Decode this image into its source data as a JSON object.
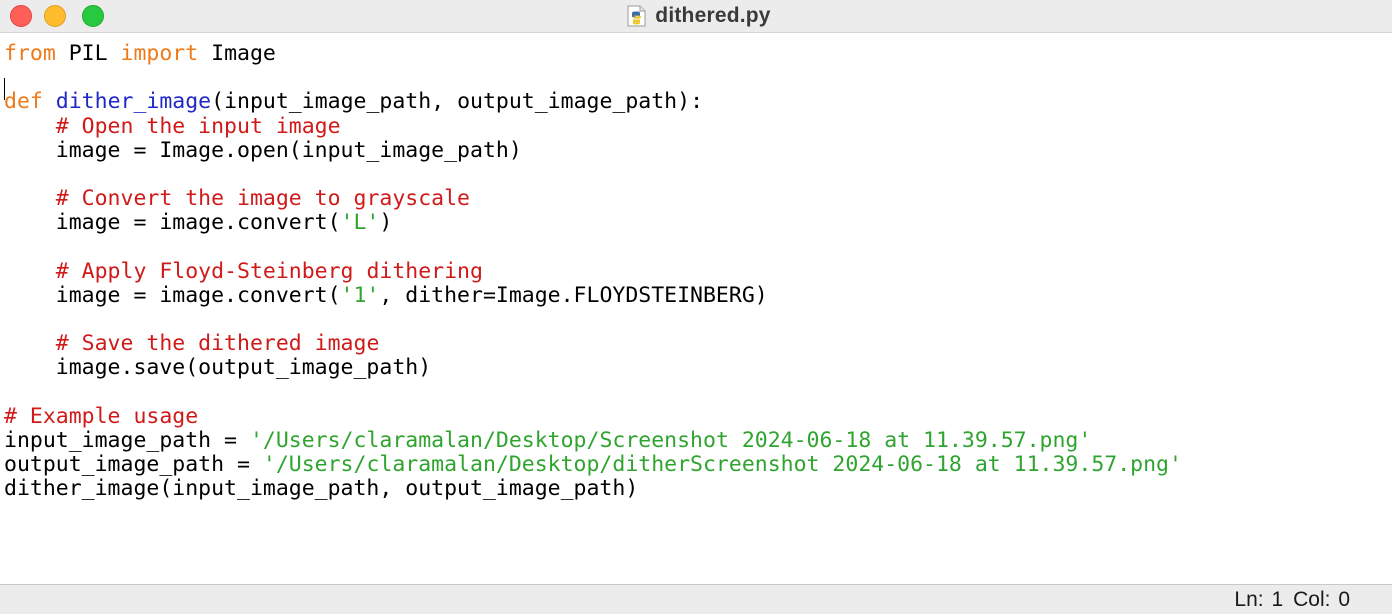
{
  "window": {
    "title": "dithered.py",
    "file_icon": "python-file-icon",
    "controls": {
      "close": {
        "name": "close-window-button",
        "color": "#ff5f57"
      },
      "minimize": {
        "name": "minimize-window-button",
        "color": "#febc2e"
      },
      "zoom": {
        "name": "zoom-window-button",
        "color": "#28c840"
      }
    }
  },
  "colors": {
    "keyword": "#ef7a1a",
    "function_name": "#1f28c7",
    "comment": "#d01a1a",
    "string": "#2fa42f",
    "text": "#000000"
  },
  "editor": {
    "lines": [
      [
        {
          "t": "from",
          "c": "kw"
        },
        {
          "t": " PIL "
        },
        {
          "t": "import",
          "c": "kw"
        },
        {
          "t": " Image"
        }
      ],
      [],
      [
        {
          "t": "def",
          "c": "kw"
        },
        {
          "t": " "
        },
        {
          "t": "dither_image",
          "c": "fn"
        },
        {
          "t": "(input_image_path, output_image_path):"
        }
      ],
      [
        {
          "t": "    "
        },
        {
          "t": "# Open the input image",
          "c": "cm"
        }
      ],
      [
        {
          "t": "    image = Image.open(input_image_path)"
        }
      ],
      [],
      [
        {
          "t": "    "
        },
        {
          "t": "# Convert the image to grayscale",
          "c": "cm"
        }
      ],
      [
        {
          "t": "    image = image.convert("
        },
        {
          "t": "'L'",
          "c": "str"
        },
        {
          "t": ")"
        }
      ],
      [],
      [
        {
          "t": "    "
        },
        {
          "t": "# Apply Floyd-Steinberg dithering",
          "c": "cm"
        }
      ],
      [
        {
          "t": "    image = image.convert("
        },
        {
          "t": "'1'",
          "c": "str"
        },
        {
          "t": ", dither=Image.FLOYDSTEINBERG)"
        }
      ],
      [],
      [
        {
          "t": "    "
        },
        {
          "t": "# Save the dithered image",
          "c": "cm"
        }
      ],
      [
        {
          "t": "    image.save(output_image_path)"
        }
      ],
      [],
      [
        {
          "t": "# Example usage",
          "c": "cm"
        }
      ],
      [
        {
          "t": "input_image_path = "
        },
        {
          "t": "'/Users/claramalan/Desktop/Screenshot 2024-06-18 at 11.39.57.png'",
          "c": "str"
        }
      ],
      [
        {
          "t": "output_image_path = "
        },
        {
          "t": "'/Users/claramalan/Desktop/ditherScreenshot 2024-06-18 at 11.39.57.png'",
          "c": "str"
        }
      ],
      [
        {
          "t": "dither_image(input_image_path, output_image_path)"
        }
      ]
    ]
  },
  "status": {
    "line": "Ln: 1",
    "column": "Col: 0"
  }
}
